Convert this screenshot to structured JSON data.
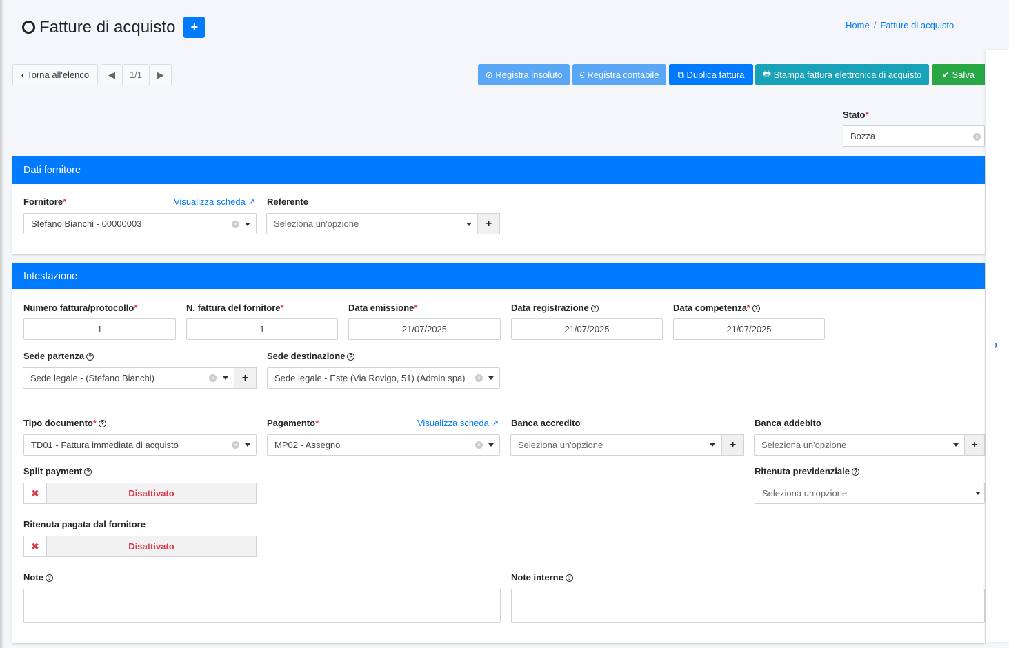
{
  "header": {
    "title": "Fatture di acquisto",
    "breadcrumb": [
      "Home",
      "Fatture di acquisto"
    ]
  },
  "nav": {
    "back": "Torna all'elenco",
    "page": "1/1"
  },
  "actions": {
    "insoluto": "Registra insoluto",
    "contabile": "Registra contabile",
    "duplica": "Duplica fattura",
    "stampa": "Stampa fattura elettronica di acquisto",
    "salva": "Salva"
  },
  "colors": {
    "primary": "#007bff",
    "light_primary": "#5aa7f5",
    "info": "#17a2b8",
    "success": "#28a745",
    "danger": "#dc3545"
  },
  "stato": {
    "label": "Stato",
    "value": "Bozza"
  },
  "fornitore_card": {
    "title": "Dati fornitore",
    "fornitore_label": "Fornitore",
    "link": "Visualizza scheda",
    "fornitore_value": "Stefano Bianchi - 00000003",
    "referente_label": "Referente",
    "referente_placeholder": "Seleziona un'opzione"
  },
  "intestazione": {
    "title": "Intestazione",
    "numero_label": "Numero fattura/protocollo",
    "numero": "1",
    "nfornitore_label": "N. fattura del fornitore",
    "nfornitore": "1",
    "emissione_label": "Data emissione",
    "emissione": "21/07/2025",
    "registrazione_label": "Data registrazione",
    "registrazione": "21/07/2025",
    "competenza_label": "Data competenza",
    "competenza": "21/07/2025",
    "partenza_label": "Sede partenza",
    "partenza": "Sede legale - (Stefano Bianchi)",
    "destinazione_label": "Sede destinazione",
    "destinazione": "Sede legale - Este (Via Rovigo, 51) (Admin spa)",
    "tipo_label": "Tipo documento",
    "tipo": "TD01 - Fattura immediata di acquisto",
    "pagamento_label": "Pagamento",
    "pagamento_link": "Visualizza scheda",
    "pagamento": "MP02 - Assegno",
    "accredito_label": "Banca accredito",
    "accredito": "Seleziona un'opzione",
    "addebito_label": "Banca addebito",
    "addebito": "Seleziona un'opzione",
    "split_label": "Split payment",
    "split": "Disattivato",
    "ritprev_label": "Ritenuta previdenziale",
    "ritprev": "Seleziona un'opzione",
    "ritpag_label": "Ritenuta pagata dal fornitore",
    "ritpag": "Disattivato",
    "note_label": "Note",
    "noteint_label": "Note interne"
  }
}
